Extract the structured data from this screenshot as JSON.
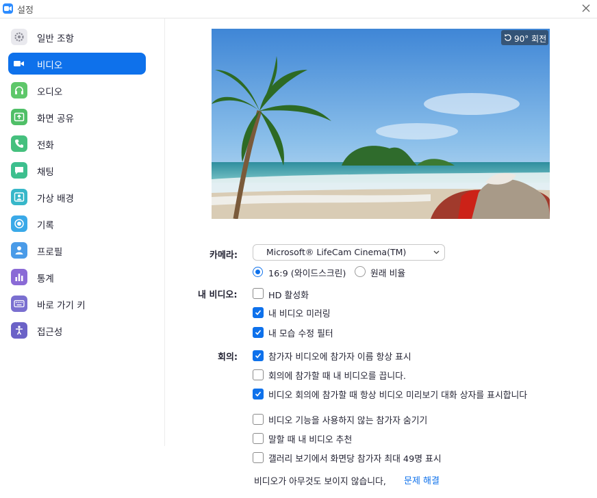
{
  "window": {
    "title": "설정"
  },
  "sidebar": {
    "items": [
      {
        "label": "일반 조항",
        "icon": "gear-icon",
        "color": "#e9e9ee",
        "active": false
      },
      {
        "label": "비디오",
        "icon": "video-camera-icon",
        "color": "#0e71eb",
        "active": true
      },
      {
        "label": "오디오",
        "icon": "headphones-icon",
        "color": "#6dc86d",
        "active": false
      },
      {
        "label": "화면 공유",
        "icon": "share-screen-icon",
        "color": "#52c06a",
        "active": false
      },
      {
        "label": "전화",
        "icon": "phone-icon",
        "color": "#45c07e",
        "active": false
      },
      {
        "label": "채팅",
        "icon": "chat-icon",
        "color": "#3dbf8e",
        "active": false
      },
      {
        "label": "가상 배경",
        "icon": "virtual-background-icon",
        "color": "#37b7c9",
        "active": false
      },
      {
        "label": "기록",
        "icon": "record-icon",
        "color": "#3aa9e8",
        "active": false
      },
      {
        "label": "프로필",
        "icon": "profile-icon",
        "color": "#4a9be8",
        "active": false
      },
      {
        "label": "통계",
        "icon": "statistics-icon",
        "color": "#8a6ad6",
        "active": false
      },
      {
        "label": "바로 가기 키",
        "icon": "keyboard-icon",
        "color": "#7a6fd0",
        "active": false
      },
      {
        "label": "접근성",
        "icon": "accessibility-icon",
        "color": "#6b62c7",
        "active": false
      }
    ]
  },
  "preview": {
    "rotate_label": "90° 회전"
  },
  "camera": {
    "label": "카메라:",
    "selected": "Microsoft® LifeCam Cinema(TM)",
    "aspect_widescreen": "16:9 (와이드스크린)",
    "aspect_original": "원래 비율",
    "aspect_selected": "widescreen"
  },
  "my_video": {
    "label": "내 비디오:",
    "options": [
      {
        "label": "HD 활성화",
        "checked": false
      },
      {
        "label": "내 비디오 미러링",
        "checked": true
      },
      {
        "label": "내 모습 수정 필터",
        "checked": true
      }
    ]
  },
  "meetings": {
    "label": "회의:",
    "options": [
      {
        "label": "참가자 비디오에 참가자 이름 항상 표시",
        "checked": true
      },
      {
        "label": "회의에 참가할 때 내 비디오를 끕니다.",
        "checked": false
      },
      {
        "label": "비디오 회의에 참가할 때 항상 비디오 미리보기 대화 상자를 표시합니다",
        "checked": true
      },
      {
        "label": "비디오 기능을 사용하지 않는 참가자 숨기기",
        "checked": false
      },
      {
        "label": "말할 때 내 비디오 추천",
        "checked": false
      },
      {
        "label": "갤러리 보기에서 화면당 참가자 최대 49명 표시",
        "checked": false
      }
    ]
  },
  "footer": {
    "help_text": "비디오가 아무것도 보이지 않습니다,",
    "troubleshoot_link": "문제 해결"
  },
  "colors": {
    "accent": "#0e71eb"
  }
}
